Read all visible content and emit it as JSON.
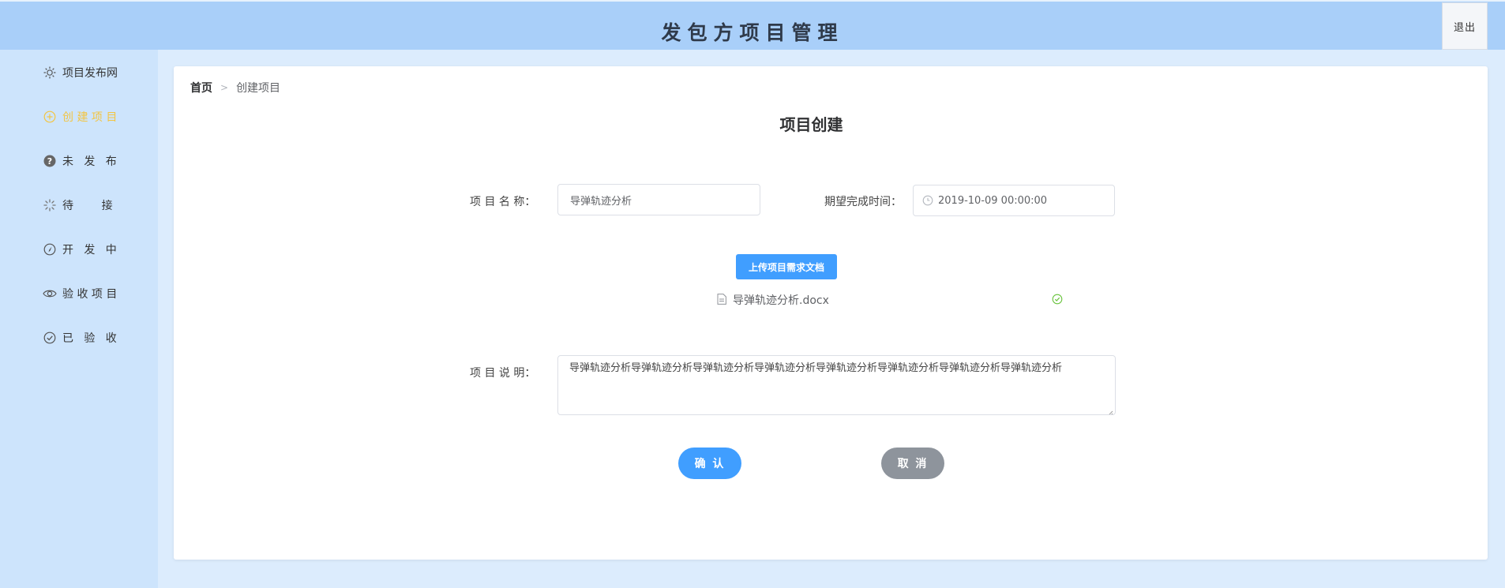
{
  "header": {
    "title": "发包方项目管理",
    "logout_label": "退出"
  },
  "sidebar": {
    "items": [
      {
        "label": "项目发布网",
        "icon": "sun-icon"
      },
      {
        "label": "创 建 项 目",
        "icon": "circle-plus-icon",
        "active": true
      },
      {
        "label": "未   发   布",
        "icon": "question-circle-icon"
      },
      {
        "label": "待        接",
        "icon": "loading-icon"
      },
      {
        "label": "开   发   中",
        "icon": "compass-icon"
      },
      {
        "label": "验 收 项 目",
        "icon": "eye-icon"
      },
      {
        "label": "已   验   收",
        "icon": "check-circle-icon"
      }
    ],
    "active_color": "#f3c543"
  },
  "breadcrumb": {
    "home": "首页",
    "current": "创建项目"
  },
  "form": {
    "title": "项目创建",
    "name_label": "项 目 名 称：",
    "name_value": "导弹轨迹分析",
    "date_label": "期望完成时间：",
    "date_value": "2019-10-09 00:00:00",
    "upload_label": "上传项目需求文档",
    "file_name": "导弹轨迹分析.docx",
    "desc_label": "项 目 说 明：",
    "desc_value": "导弹轨迹分析导弹轨迹分析导弹轨迹分析导弹轨迹分析导弹轨迹分析导弹轨迹分析导弹轨迹分析导弹轨迹分析",
    "confirm_label": "确 认",
    "cancel_label": "取 消"
  },
  "colors": {
    "primary": "#409eff",
    "header_bg": "#a9cff9",
    "success": "#67c23a"
  }
}
